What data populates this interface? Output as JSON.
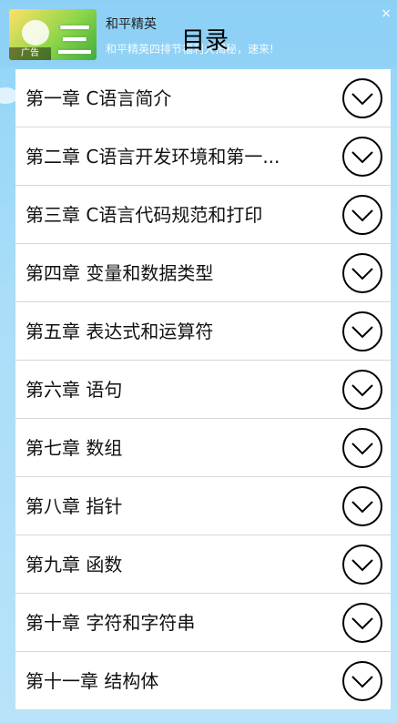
{
  "ad": {
    "title": "和平精英",
    "description": "和平精英四排节福利大揭秘，速来!",
    "close": "×",
    "thumb_glyph": "三",
    "thumb_tag": "广告"
  },
  "page": {
    "title": "目录"
  },
  "chapters": [
    {
      "label": "第一章 C语言简介",
      "icon": "chevron-down-circle-icon"
    },
    {
      "label": "第二章 C语言开发环境和第一...",
      "icon": "chevron-down-circle-icon"
    },
    {
      "label": "第三章 C语言代码规范和打印",
      "icon": "chevron-down-circle-icon"
    },
    {
      "label": "第四章 变量和数据类型",
      "icon": "chevron-down-circle-icon"
    },
    {
      "label": "第五章 表达式和运算符",
      "icon": "chevron-down-circle-icon"
    },
    {
      "label": "第六章 语句",
      "icon": "chevron-down-circle-icon"
    },
    {
      "label": "第七章 数组",
      "icon": "chevron-down-circle-icon"
    },
    {
      "label": "第八章 指针",
      "icon": "chevron-down-circle-icon"
    },
    {
      "label": "第九章 函数",
      "icon": "chevron-down-circle-icon"
    },
    {
      "label": "第十章 字符和字符串",
      "icon": "chevron-down-circle-icon"
    },
    {
      "label": "第十一章 结构体",
      "icon": "chevron-down-circle-icon"
    }
  ]
}
